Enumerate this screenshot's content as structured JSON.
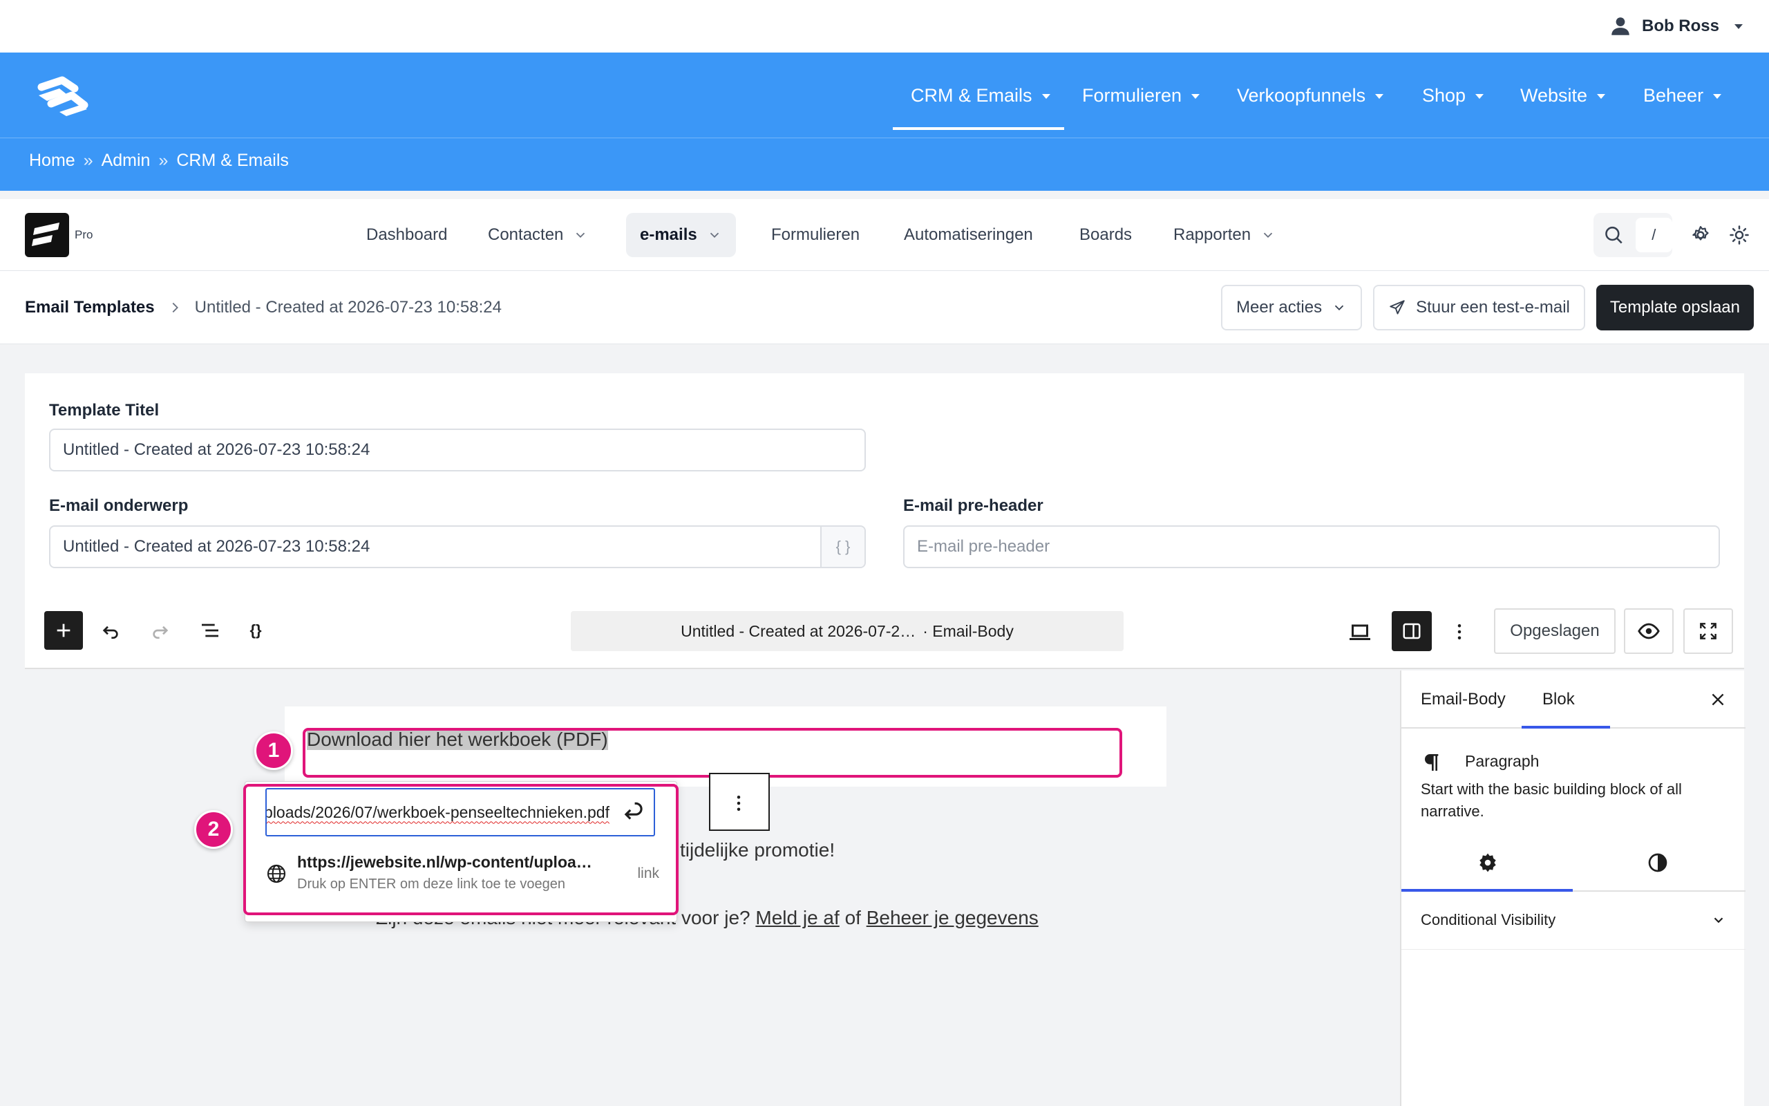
{
  "wp_admin_bar": {
    "user_name": "Bob Ross"
  },
  "site_nav": {
    "items": [
      {
        "label": "CRM & Emails"
      },
      {
        "label": "Formulieren"
      },
      {
        "label": "Verkoopfunnels"
      },
      {
        "label": "Shop"
      },
      {
        "label": "Website"
      },
      {
        "label": "Beheer"
      }
    ],
    "active": "CRM & Emails"
  },
  "breadcrumb": {
    "items": [
      "Home",
      "Admin",
      "CRM & Emails"
    ],
    "separator": "»"
  },
  "fluentcrm_nav": {
    "badge": "Pro",
    "items": [
      {
        "label": "Dashboard"
      },
      {
        "label": "Contacten"
      },
      {
        "label": "e-mails"
      },
      {
        "label": "Formulieren"
      },
      {
        "label": "Automatiseringen"
      },
      {
        "label": "Boards"
      },
      {
        "label": "Rapporten"
      }
    ],
    "active": "e-mails",
    "search_shortcut": "/"
  },
  "page_header": {
    "root": "Email Templates",
    "current": "Untitled - Created at 2026-07-23 10:58:24",
    "more_actions": "Meer acties",
    "send_test": "Stuur een test-e-mail",
    "save": "Template opslaan"
  },
  "form": {
    "title_label": "Template Titel",
    "title_value": "Untitled - Created at 2026-07-23 10:58:24",
    "subject_label": "E-mail onderwerp",
    "subject_value": "Untitled - Created at 2026-07-23 10:58:24",
    "subject_var_button": "{ }",
    "preheader_label": "E-mail pre-header",
    "preheader_placeholder": "E-mail pre-header"
  },
  "editor": {
    "doc_title": "Untitled - Created at 2026-07-2…",
    "doc_type": "· Email-Body",
    "saved_label": "Opgeslagen"
  },
  "canvas": {
    "paragraph_selected": "Download hier het werkboek (PDF)",
    "line2": "tijdelijke promotie!",
    "line3_prefix": "Zijn deze emails niet meer relevant voor je?",
    "unsubscribe": "Meld je af",
    "line3_mid": "of",
    "manage": "Beheer je gegevens"
  },
  "link_popover": {
    "url_value": "https://jewebsite.nl/wp-content/uploads/2026/07/werkboek-penseeltechnieken.pdf",
    "suggestion_url": "https://jewebsite.nl/wp-content/uploa…",
    "suggestion_hint": "Druk op ENTER om deze link toe te voegen",
    "suggestion_type": "link"
  },
  "annotations": {
    "badge1": "1",
    "badge2": "2",
    "color": "#e0157a"
  },
  "sidebar": {
    "tabs": [
      "Email-Body",
      "Blok"
    ],
    "active_tab": "Blok",
    "block_name": "Paragraph",
    "block_desc": "Start with the basic building block of all narrative.",
    "panel": "Conditional Visibility"
  },
  "colors": {
    "brand_blue": "#3b97f7",
    "dark_button": "#1f2328",
    "wp_blue": "#3858e9"
  }
}
